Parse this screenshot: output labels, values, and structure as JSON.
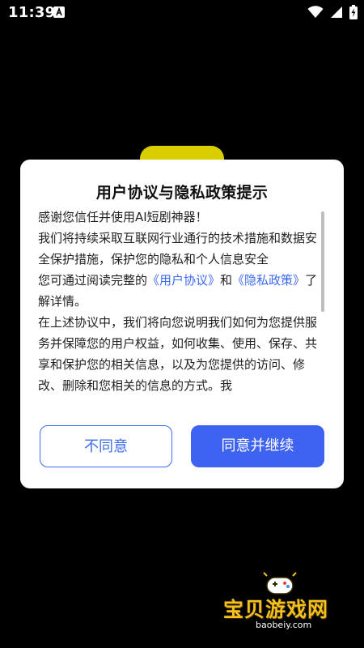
{
  "status_bar": {
    "time": "11:39",
    "notification_icon": "a-letter-icon",
    "wifi_icon": "wifi-icon",
    "signal_icon": "signal-icon",
    "battery_icon": "battery-charging-icon"
  },
  "dialog": {
    "title": "用户协议与隐私政策提示",
    "greeting": "感谢您信任并使用AI短剧神器！",
    "para1_prefix": "我们将持续采取互联网行业通行的技术措施和数据安全保护措施，保护您的隐私和个人信息安全",
    "para2_prefix": "您可通过阅读完整的",
    "user_agreement_link": "《用户协议》",
    "para2_and": "和",
    "privacy_policy_link": "《隐私政策》",
    "para2_suffix": "了解详情。",
    "para3": "在上述协议中，我们将向您说明我们如何为您提供服务并保障您的用户权益，如何收集、使用、保存、共享和保护您的相关信息，以及为您提供的访问、修改、删除和您相关的信息的方式。我",
    "disagree_label": "不同意",
    "agree_label": "同意并继续"
  },
  "watermark": {
    "brand": "宝贝游戏网",
    "url": "baobeiy.com"
  },
  "colors": {
    "accent": "#3d63f0",
    "link": "#3d6cf0",
    "background": "#000000",
    "dialog_bg": "#ffffff"
  }
}
